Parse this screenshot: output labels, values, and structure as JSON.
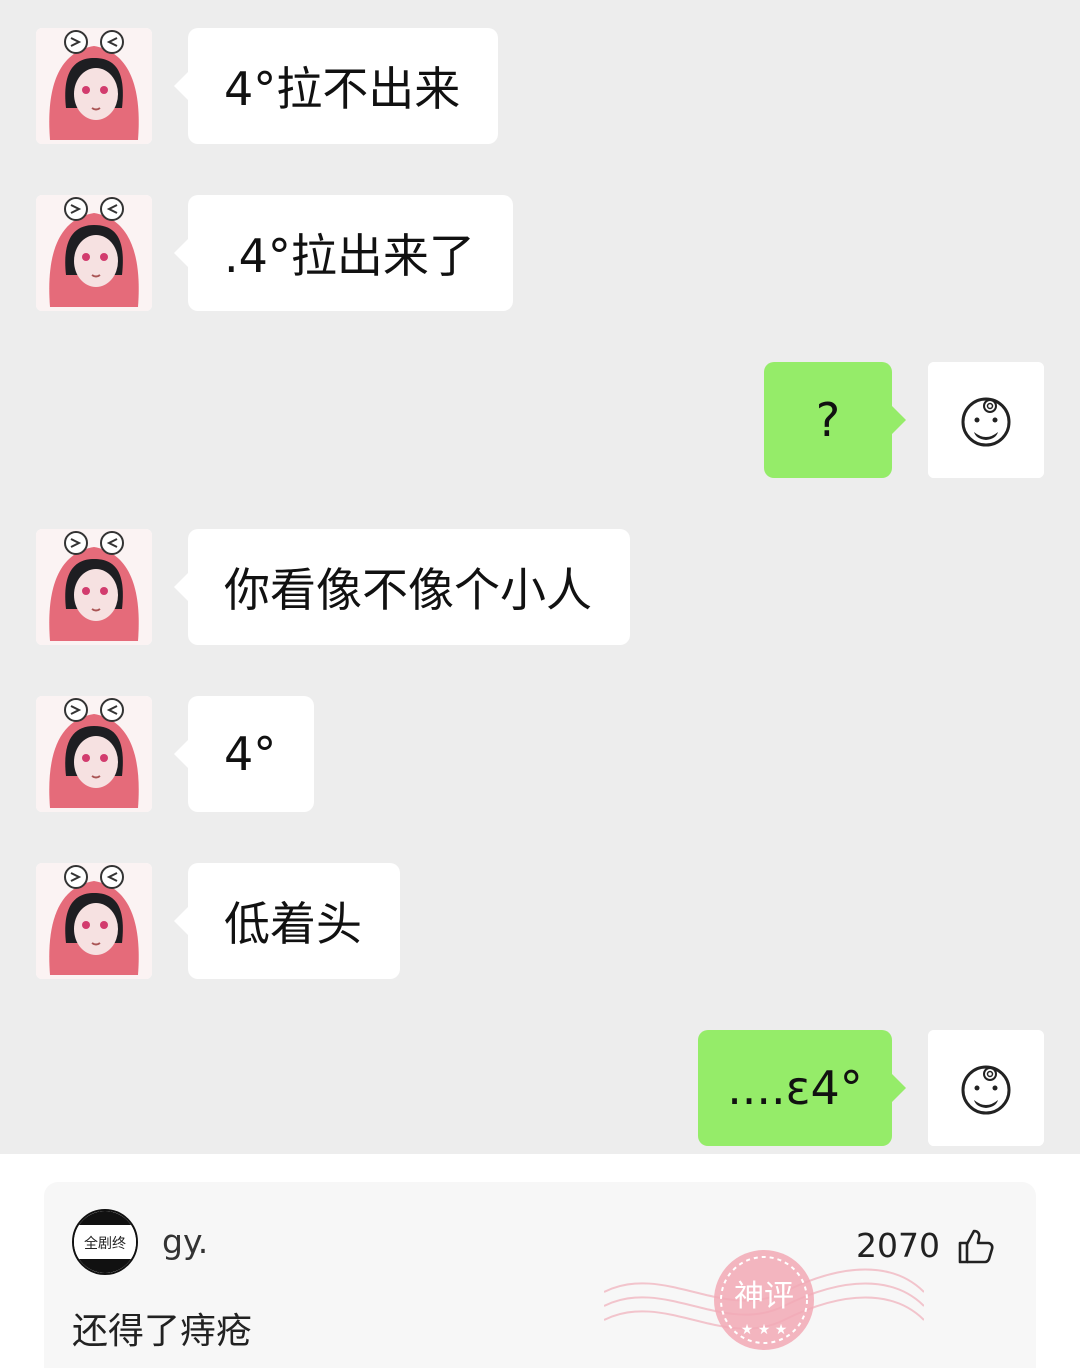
{
  "chat": {
    "messages": [
      {
        "side": "in",
        "text": "4°拉不出来"
      },
      {
        "side": "in",
        "text": ".4°拉出来了"
      },
      {
        "side": "out",
        "text": "?"
      },
      {
        "side": "in",
        "text": "你看像不像个小人"
      },
      {
        "side": "in",
        "text": "4°"
      },
      {
        "side": "in",
        "text": "低着头"
      },
      {
        "side": "out",
        "text": "....ε4°"
      }
    ]
  },
  "comment": {
    "avatar_text": "全剧终",
    "username": "gy.",
    "likes": "2070",
    "text": "还得了痔疮",
    "stamp_text": "神评"
  },
  "colors": {
    "chat_bg": "#ededed",
    "incoming_bubble": "#ffffff",
    "outgoing_bubble": "#95ec69",
    "stamp": "#f2a9b5"
  }
}
